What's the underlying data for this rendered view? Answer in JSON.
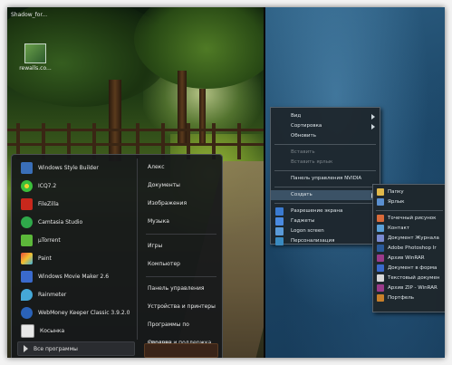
{
  "desktop": {
    "top_label": "Shadow_for...",
    "icon_label": "rewalls.co...",
    "colors": {
      "wallpaper_right": "#1f4a6c",
      "menu_bg": "#16181a"
    }
  },
  "start_menu": {
    "programs": [
      {
        "label": "Windows Style Builder",
        "icon": "style-builder-icon",
        "color": "#3a6fb8"
      },
      {
        "label": "ICQ7.2",
        "icon": "icq-flower-icon",
        "color": "#3bbf3b"
      },
      {
        "label": "FileZilla",
        "icon": "filezilla-icon",
        "color": "#c8281c"
      },
      {
        "label": "Camtasia Studio",
        "icon": "camtasia-icon",
        "color": "#2fa84a"
      },
      {
        "label": "µTorrent",
        "icon": "utorrent-icon",
        "color": "#5cb83a"
      },
      {
        "label": "Paint",
        "icon": "paint-icon",
        "color": "#d6a23a"
      },
      {
        "label": "Windows Movie Maker 2.6",
        "icon": "movie-maker-icon",
        "color": "#3a6acc"
      },
      {
        "label": "Rainmeter",
        "icon": "rainmeter-icon",
        "color": "#45a8d8"
      },
      {
        "label": "WebMoney Keeper Classic 3.9.2.0",
        "icon": "webmoney-icon",
        "color": "#2a62b8"
      },
      {
        "label": "Косынка",
        "icon": "solitaire-icon",
        "color": "#e8e8e8"
      }
    ],
    "all_programs": "Все программы",
    "right_items": [
      "Алекс",
      "Документы",
      "Изображения",
      "Музыка",
      "Игры",
      "Компьютер",
      "Панель управления",
      "Устройства и принтеры",
      "Программы по умолчан...",
      "Справка и поддержка"
    ]
  },
  "context_menu": {
    "items": [
      {
        "label": "Вид",
        "submenu": true,
        "disabled": false,
        "icon": ""
      },
      {
        "label": "Сортировка",
        "submenu": true,
        "disabled": false,
        "icon": ""
      },
      {
        "label": "Обновить",
        "submenu": false,
        "disabled": false,
        "icon": ""
      },
      {
        "label": "Вставить",
        "submenu": false,
        "disabled": true,
        "icon": ""
      },
      {
        "label": "Вставить ярлык",
        "submenu": false,
        "disabled": true,
        "icon": ""
      },
      {
        "label": "Панель управления NVIDIA",
        "submenu": false,
        "disabled": false,
        "icon": ""
      },
      {
        "label": "Создать",
        "submenu": true,
        "disabled": false,
        "icon": ""
      },
      {
        "label": "Разрешение экрана",
        "submenu": false,
        "disabled": false,
        "icon": "display-icon"
      },
      {
        "label": "Гаджеты",
        "submenu": false,
        "disabled": false,
        "icon": "gadgets-icon"
      },
      {
        "label": "Logon screen",
        "submenu": false,
        "disabled": false,
        "icon": "logon-icon"
      },
      {
        "label": "Персонализация",
        "submenu": false,
        "disabled": false,
        "icon": "personalize-icon"
      }
    ]
  },
  "submenu": {
    "items": [
      {
        "label": "Папку",
        "icon": "folder-icon",
        "color": "#e0b84a"
      },
      {
        "label": "Ярлык",
        "icon": "shortcut-icon",
        "color": "#5a8fd0"
      },
      {
        "label": "Точечный рисунок",
        "icon": "bitmap-icon",
        "color": "#d86a3a"
      },
      {
        "label": "Контакт",
        "icon": "contact-icon",
        "color": "#5aa0d8"
      },
      {
        "label": "Документ Журнала",
        "icon": "journal-icon",
        "color": "#7a8ad0"
      },
      {
        "label": "Adobe Photoshop Ir",
        "icon": "photoshop-icon",
        "color": "#2a5a9a"
      },
      {
        "label": "Архив WinRAR",
        "icon": "winrar-icon",
        "color": "#9a3a8a"
      },
      {
        "label": "Документ в форма",
        "icon": "doc-format-icon",
        "color": "#3a6acc"
      },
      {
        "label": "Текстовый докумен",
        "icon": "text-doc-icon",
        "color": "#d8d8d8"
      },
      {
        "label": "Архив ZIP - WinRAR",
        "icon": "zip-icon",
        "color": "#9a3a8a"
      },
      {
        "label": "Портфель",
        "icon": "briefcase-icon",
        "color": "#c8802a"
      }
    ]
  }
}
